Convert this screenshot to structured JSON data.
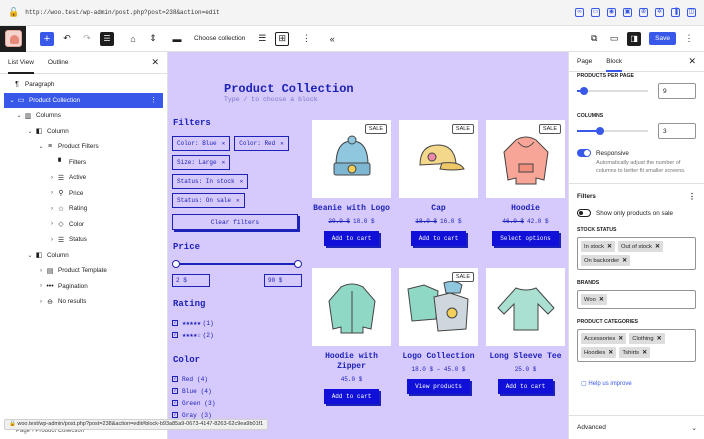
{
  "browser": {
    "url": "http://woo.test/wp-admin/post.php?post=238&action=edit"
  },
  "toolbar": {
    "choose_collection": "Choose collection",
    "save": "Save"
  },
  "left_panel": {
    "tabs": [
      "List View",
      "Outline"
    ],
    "items": [
      {
        "label": "Paragraph",
        "icon": "¶",
        "level": 0,
        "chev": ""
      },
      {
        "label": "Product Collection",
        "icon": "▭",
        "level": 0,
        "chev": "⌄",
        "selected": true
      },
      {
        "label": "Columns",
        "icon": "▥",
        "level": 1,
        "chev": "⌄"
      },
      {
        "label": "Column",
        "icon": "◧",
        "level": 2,
        "chev": "⌄"
      },
      {
        "label": "Product Filters",
        "icon": "≡",
        "level": 3,
        "chev": "⌄"
      },
      {
        "label": "Filters",
        "icon": "▘",
        "level": 4,
        "chev": ""
      },
      {
        "label": "Active",
        "icon": "☰",
        "level": 4,
        "chev": "›"
      },
      {
        "label": "Price",
        "icon": "⚲",
        "level": 4,
        "chev": "›"
      },
      {
        "label": "Rating",
        "icon": "☆",
        "level": 4,
        "chev": "›"
      },
      {
        "label": "Color",
        "icon": "◇",
        "level": 4,
        "chev": "›"
      },
      {
        "label": "Status",
        "icon": "☰",
        "level": 4,
        "chev": "›"
      },
      {
        "label": "Column",
        "icon": "◧",
        "level": 2,
        "chev": "⌄"
      },
      {
        "label": "Product Template",
        "icon": "▤",
        "level": 3,
        "chev": "›"
      },
      {
        "label": "Pagination",
        "icon": "•••",
        "level": 3,
        "chev": "›"
      },
      {
        "label": "No results",
        "icon": "⊖",
        "level": 3,
        "chev": "›"
      }
    ]
  },
  "canvas": {
    "title": "Product Collection",
    "subtitle": "Type / to choose a block",
    "filters_heading": "Filters",
    "active_chips": [
      "Color: Blue",
      "Color: Red",
      "Size: Large",
      "Status: In stock",
      "Status: On sale"
    ],
    "clear_filters": "Clear filters",
    "price_heading": "Price",
    "price_min": "2 $",
    "price_max": "90 $",
    "rating_heading": "Rating",
    "ratings": [
      {
        "stars": "★★★★★",
        "count": "(1)"
      },
      {
        "stars": "★★★★☆",
        "count": "(2)"
      }
    ],
    "color_heading": "Color",
    "colors": [
      "Red (4)",
      "Blue (4)",
      "Green (3)",
      "Gray (3)"
    ],
    "products_row1": [
      {
        "name": "Beanie with Logo",
        "old": "20.0 $",
        "price": "18.0 $",
        "button": "Add to cart",
        "sale": "SALE"
      },
      {
        "name": "Cap",
        "old": "18.0 $",
        "price": "16.0 $",
        "button": "Add to cart",
        "sale": "SALE"
      },
      {
        "name": "Hoodie",
        "old": "46.0 $",
        "price": "42.0 $",
        "button": "Select options",
        "sale": "SALE"
      }
    ],
    "products_row2": [
      {
        "name": "Hoodie with Zipper",
        "old": "",
        "price": "45.0 $",
        "button": "Add to cart",
        "sale": ""
      },
      {
        "name": "Logo Collection",
        "old": "",
        "price": "18.0 $ – 45.0 $",
        "button": "View products",
        "sale": "SALE"
      },
      {
        "name": "Long Sleeve Tee",
        "old": "",
        "price": "25.0 $",
        "button": "Add to cart",
        "sale": ""
      }
    ]
  },
  "right_panel": {
    "tabs": [
      "Page",
      "Block"
    ],
    "products_per_page_label": "PRODUCTS PER PAGE",
    "products_per_page_value": "9",
    "products_per_page_fraction": 0.1,
    "columns_label": "COLUMNS",
    "columns_value": "3",
    "columns_fraction": 0.33,
    "responsive_label": "Responsive",
    "responsive_help": "Automatically adjust the number of columns to better fit smaller screens.",
    "filters_section": "Filters",
    "only_sale_label": "Show only products on sale",
    "stock_label": "STOCK STATUS",
    "stock_tokens": [
      "In stock",
      "Out of stock",
      "On backorder"
    ],
    "brands_label": "BRANDS",
    "brand_tokens": [
      "Woo"
    ],
    "categories_label": "PRODUCT CATEGORIES",
    "category_tokens": [
      "Accessories",
      "Clothing",
      "Hoodies",
      "Tshirts"
    ],
    "help_link": "Help us improve",
    "advanced": "Advanced"
  },
  "status_bar": {
    "url": "woo.test/wp-admin/post.php?post=238&action=edit#block-b93a85a9-0673-4147-8263-62c9ea9b01f1",
    "crumb": "Page  ›  Product Collection"
  },
  "colors": {
    "accent": "#3858e9",
    "canvas_bg": "#d6c9fb",
    "theme_blue": "#1d22b8"
  }
}
